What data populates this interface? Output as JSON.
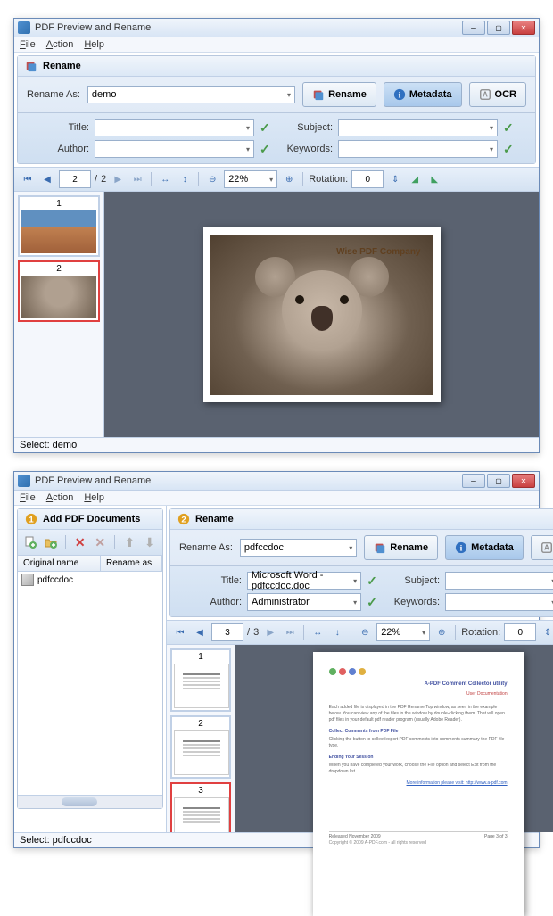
{
  "window1": {
    "title": "PDF Preview and Rename",
    "menu": {
      "file": "File",
      "action": "Action",
      "help": "Help"
    },
    "panel_title": "Rename",
    "rename_as_label": "Rename As:",
    "rename_as_value": "demo",
    "btn_rename": "Rename",
    "btn_metadata": "Metadata",
    "btn_ocr": "OCR",
    "meta": {
      "title_label": "Title:",
      "title_value": "",
      "subject_label": "Subject:",
      "subject_value": "",
      "author_label": "Author:",
      "author_value": "",
      "keywords_label": "Keywords:",
      "keywords_value": ""
    },
    "nav": {
      "page": "2",
      "total": "2",
      "zoom": "22%",
      "rotation_label": "Rotation:",
      "rotation": "0",
      "sep": "/"
    },
    "thumbs": [
      {
        "num": "1"
      },
      {
        "num": "2"
      }
    ],
    "preview_watermark": "Wise PDF Company",
    "status": "Select: demo"
  },
  "window2": {
    "title": "PDF Preview and Rename",
    "menu": {
      "file": "File",
      "action": "Action",
      "help": "Help"
    },
    "left_panel_title": "Add PDF Documents",
    "columns": {
      "orig": "Original name",
      "renamed": "Rename as"
    },
    "docs": [
      {
        "name": "pdfccdoc"
      }
    ],
    "panel_title": "Rename",
    "rename_as_label": "Rename As:",
    "rename_as_value": "pdfccdoc",
    "btn_rename": "Rename",
    "btn_metadata": "Metadata",
    "btn_ocr": "OCR",
    "meta": {
      "title_label": "Title:",
      "title_value": "Microsoft Word - pdfccdoc.doc",
      "subject_label": "Subject:",
      "subject_value": "",
      "author_label": "Author:",
      "author_value": "Administrator",
      "keywords_label": "Keywords:",
      "keywords_value": ""
    },
    "nav": {
      "page": "3",
      "total": "3",
      "zoom": "22%",
      "rotation_label": "Rotation:",
      "rotation": "0",
      "sep": "/"
    },
    "thumbs": [
      {
        "num": "1"
      },
      {
        "num": "2"
      },
      {
        "num": "3"
      }
    ],
    "doc_preview": {
      "title": "A-PDF Comment Collector utility",
      "sub": "User Documentation",
      "p1": "Each added file is displayed in the PDF Rename Top window, as seen in the example below. You can view any of the files in the window by double-clicking them. That will open pdf files in your default pdf reader program (usually Adobe Reader).",
      "h1": "Collect Comments from PDF File",
      "p2": "Clicking the button to collect/export PDF comments into comments summary the PDF file type.",
      "h2": "Ending Your Session",
      "p3": "When you have completed your work, choose the File option and select Exit from the dropdown list.",
      "link": "More information please visit: http://www.a-pdf.com",
      "footer_l": "Released November 2009",
      "footer_r": "Page 3 of 3",
      "copyright": "Copyright © 2009 A-PDF.com - all rights reserved"
    },
    "status": "Select: pdfccdoc"
  }
}
